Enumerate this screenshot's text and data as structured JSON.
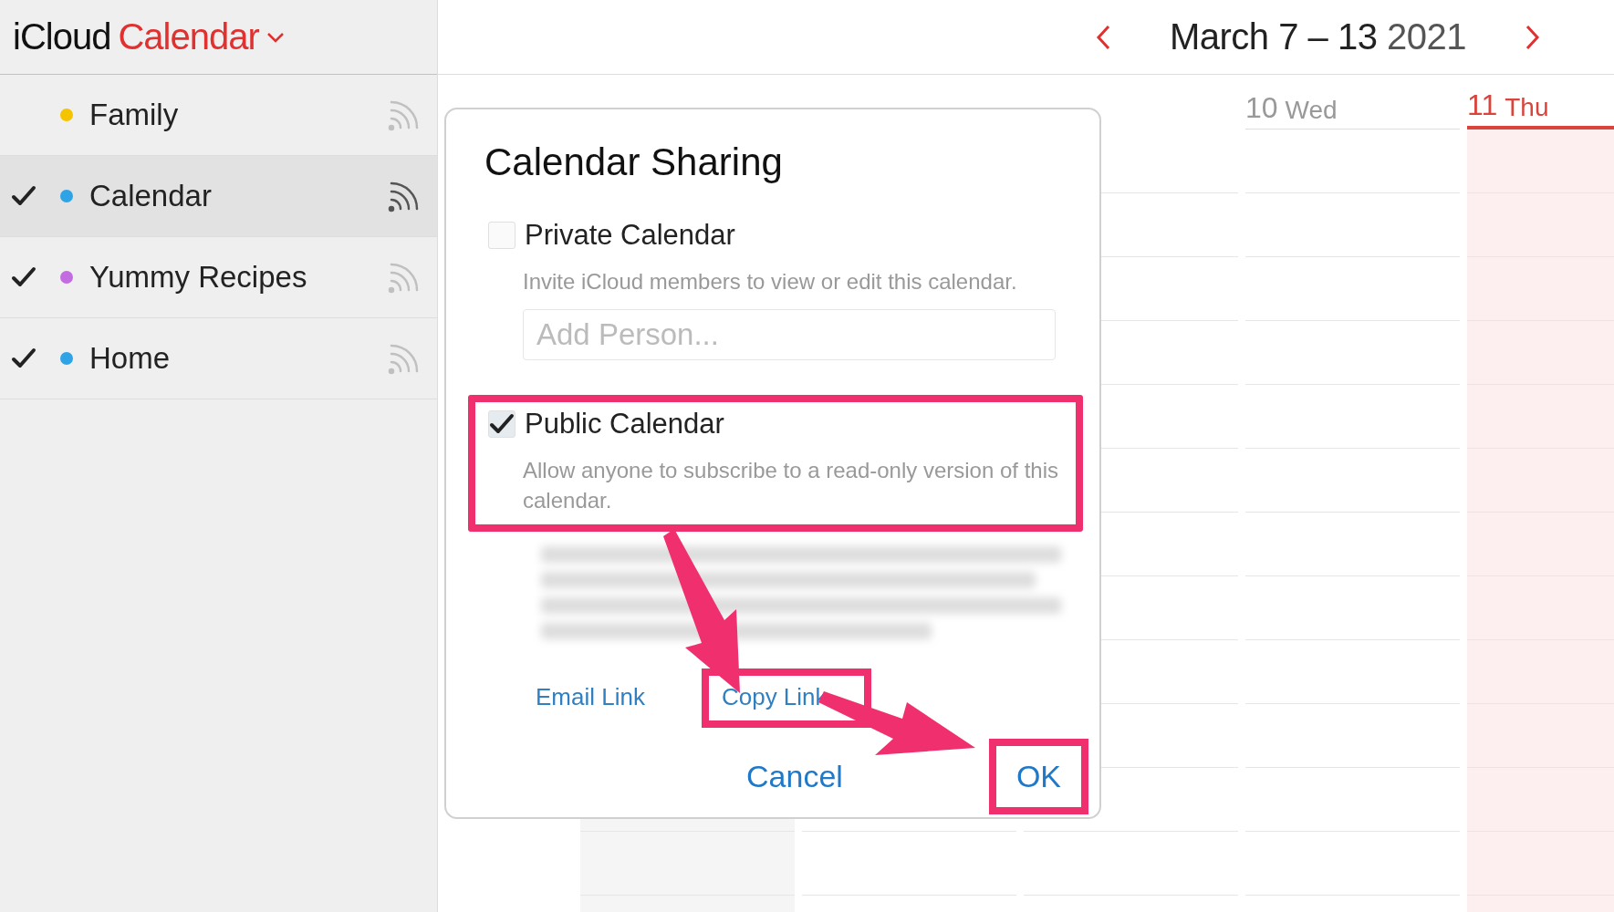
{
  "app": {
    "brand": "iCloud",
    "title": "Calendar"
  },
  "sidebar": {
    "calendars": [
      {
        "name": "Family",
        "color": "#f5c400",
        "checked": false,
        "selected": false
      },
      {
        "name": "Calendar",
        "color": "#2ea3e6",
        "checked": true,
        "selected": true
      },
      {
        "name": "Yummy Recipes",
        "color": "#c36be0",
        "checked": true,
        "selected": false
      },
      {
        "name": "Home",
        "color": "#2ea3e6",
        "checked": true,
        "selected": false
      }
    ]
  },
  "header": {
    "range": "March 7 – 13",
    "year": "2021"
  },
  "days": [
    {
      "num": "10",
      "day": "Wed",
      "today": false
    },
    {
      "num": "11",
      "day": "Thu",
      "today": true
    }
  ],
  "dialog": {
    "title": "Calendar Sharing",
    "options": [
      {
        "kind": "private",
        "label": "Private Calendar",
        "checked": false,
        "highlighted": false,
        "description": "Invite iCloud members to view or edit this calendar.",
        "placeholder": "Add Person..."
      },
      {
        "kind": "public",
        "label": "Public Calendar",
        "checked": true,
        "highlighted": true,
        "description": "Allow anyone to subscribe to a read-only version of this calendar."
      }
    ],
    "links": [
      {
        "label": "Email Link",
        "highlighted": false
      },
      {
        "label": "Copy Link",
        "highlighted": true
      }
    ],
    "buttons": [
      {
        "label": "Cancel",
        "highlighted": false
      },
      {
        "label": "OK",
        "highlighted": true
      }
    ]
  }
}
